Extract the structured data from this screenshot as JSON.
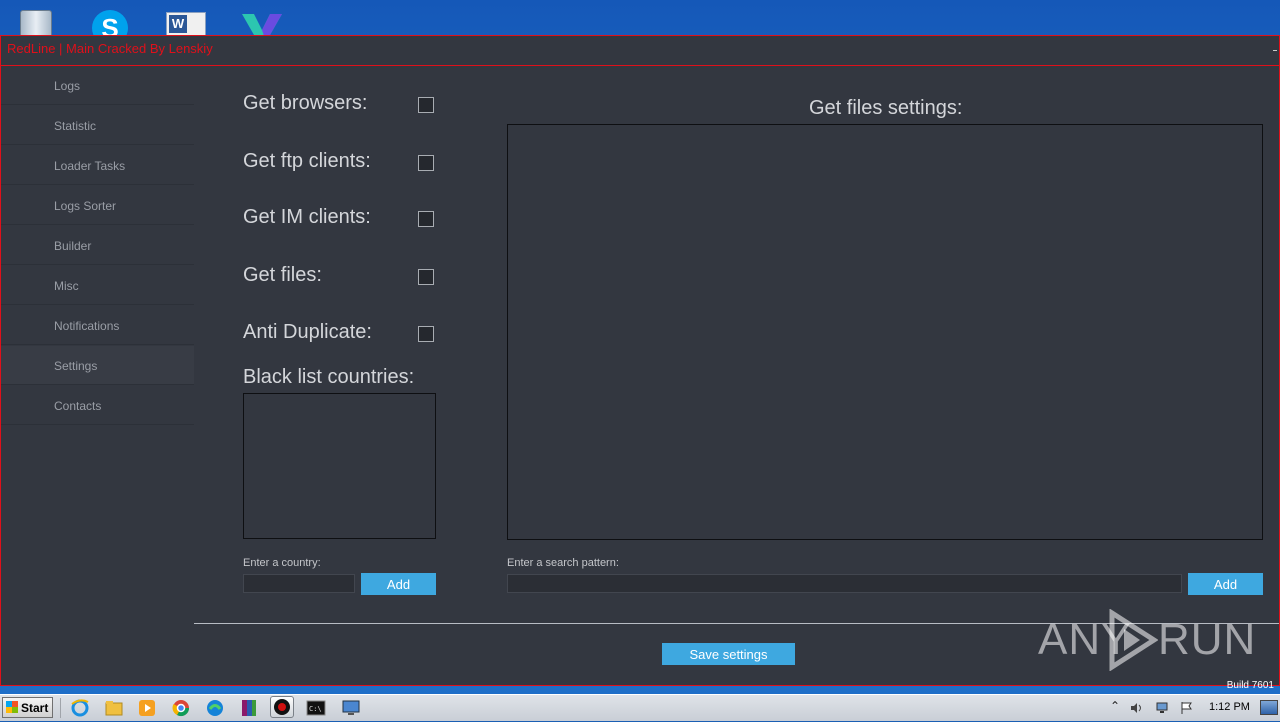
{
  "window": {
    "title": "RedLine | Main Cracked By Lenskiy"
  },
  "sidebar": {
    "items": [
      {
        "label": "Logs"
      },
      {
        "label": "Statistic"
      },
      {
        "label": "Loader Tasks"
      },
      {
        "label": "Logs Sorter"
      },
      {
        "label": "Builder"
      },
      {
        "label": "Misc"
      },
      {
        "label": "Notifications"
      },
      {
        "label": "Settings",
        "active": true
      },
      {
        "label": "Contacts"
      }
    ]
  },
  "settings": {
    "options": [
      {
        "label": "Get browsers:",
        "checked": false
      },
      {
        "label": "Get ftp clients:",
        "checked": false
      },
      {
        "label": "Get IM clients:",
        "checked": false
      },
      {
        "label": "Get files:",
        "checked": false
      },
      {
        "label": "Anti Duplicate:",
        "checked": false
      }
    ],
    "blacklist_title": "Black list countries:",
    "country_label": "Enter a country:",
    "country_value": "",
    "country_add_label": "Add",
    "files_title": "Get files settings:",
    "pattern_label": "Enter a search pattern:",
    "pattern_value": "",
    "pattern_add_label": "Add",
    "save_label": "Save settings"
  },
  "watermark": {
    "left": "ANY",
    "right": "RUN"
  },
  "desktop": {
    "build_text": "Build 7601",
    "icons": [
      "recycle-bin-icon",
      "skype-icon",
      "word-icon",
      "veeam-icon"
    ]
  },
  "taskbar": {
    "start_label": "Start",
    "clock": "1:12 PM",
    "apps": [
      "ie-icon",
      "explorer-icon",
      "media-player-icon",
      "chrome-icon",
      "edge-icon",
      "winrar-icon",
      "redline-icon",
      "cmd-icon",
      "remote-icon"
    ]
  },
  "colors": {
    "accent": "#3ea8e0",
    "window_bg": "#333740",
    "border": "#e0101a"
  }
}
